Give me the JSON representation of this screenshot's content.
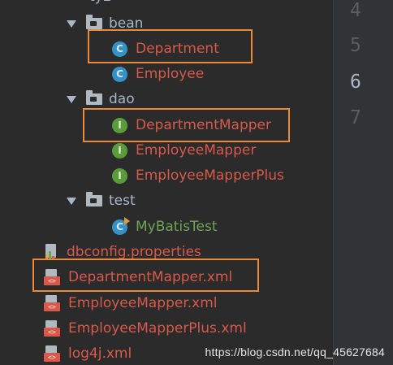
{
  "tree": {
    "partial_top": "ty2",
    "items": [
      {
        "label": "bean"
      },
      {
        "label": "Department",
        "icon_letter": "C"
      },
      {
        "label": "Employee",
        "icon_letter": "C"
      },
      {
        "label": "dao"
      },
      {
        "label": "DepartmentMapper",
        "icon_letter": "I"
      },
      {
        "label": "EmployeeMapper",
        "icon_letter": "I"
      },
      {
        "label": "EmployeeMapperPlus",
        "icon_letter": "I"
      },
      {
        "label": "test"
      },
      {
        "label": "MyBatisTest",
        "icon_letter": "C"
      },
      {
        "label": "dbconfig.properties"
      },
      {
        "label": "DepartmentMapper.xml"
      },
      {
        "label": "EmployeeMapper.xml"
      },
      {
        "label": "EmployeeMapperPlus.xml"
      },
      {
        "label": "log4j.xml"
      }
    ],
    "xml_tag": "<>"
  },
  "gutter": {
    "line_numbers": [
      "4",
      "5",
      "6",
      "7"
    ],
    "current_line": "6"
  },
  "watermark": "https://blog.csdn.net/qq_45627684",
  "colors": {
    "background": "#2b2b2b",
    "highlight_box": "#e98a3a",
    "file_red": "#d8594a",
    "test_green": "#6fa457",
    "class_blue": "#3592c4",
    "interface_green": "#5b9c3a"
  }
}
